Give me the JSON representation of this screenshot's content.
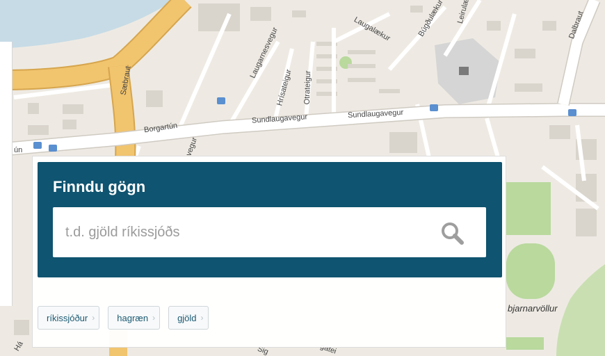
{
  "map": {
    "streets": [
      "Laugarnesvegur",
      "Laugalækur",
      "Búgðulækur",
      "Leirulæ",
      "Dalbraut",
      "Sæbraut",
      "Hrísateigur",
      "Otrateigur",
      "Borgartún",
      "Sundlaugavegur",
      "Sundlaugavegur",
      "ún",
      "vegur",
      "Há",
      "Sig",
      "gatei"
    ],
    "place": "bjarnarvöllur"
  },
  "finder": {
    "title": "Finndu gögn",
    "search_placeholder": "t.d. gjöld ríkissjóðs",
    "search_value": "",
    "search_icon": "magnifier-icon"
  },
  "tags": [
    {
      "label": "ríkissjóður"
    },
    {
      "label": "hagræn"
    },
    {
      "label": "gjöld"
    }
  ],
  "colors": {
    "panel_blue": "#0f5470",
    "water": "#c6dbe6",
    "arterial_road": "#f1c46e",
    "green": "#c3dfa9",
    "tag_text": "#1c5a72"
  }
}
